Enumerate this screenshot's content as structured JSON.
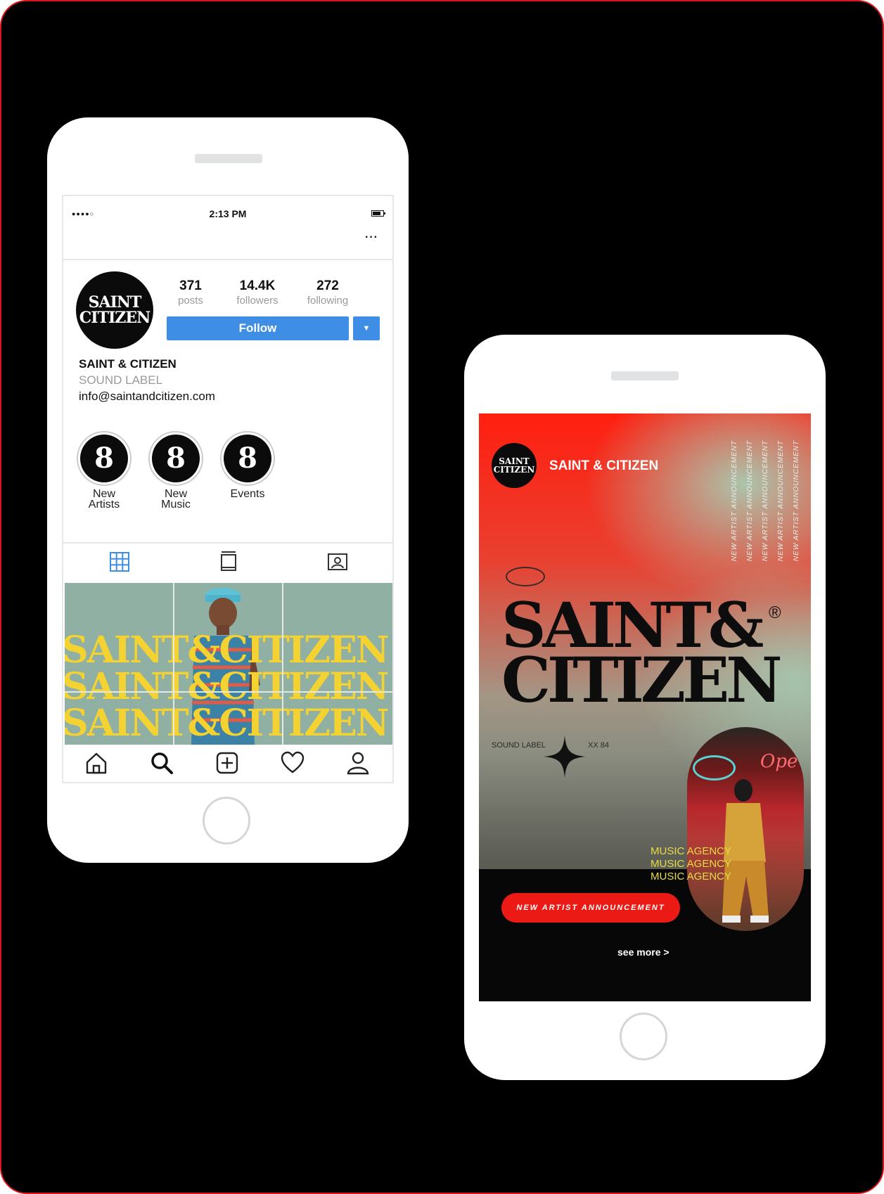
{
  "colors": {
    "background": "#000000",
    "border_accent": "#d9141c",
    "follow_blue": "#3f8ee6",
    "announce_red": "#ec1a14",
    "agency_yellow": "#e6dc46"
  },
  "profile_phone": {
    "status": {
      "signal": "●●●●○",
      "time": "2:13 PM"
    },
    "more_menu": "···",
    "avatar_logo": {
      "line1": "SAINT",
      "line2": "CITIZEN"
    },
    "stats": [
      {
        "num": "371",
        "label": "posts"
      },
      {
        "num": "14.4K",
        "label": "followers"
      },
      {
        "num": "272",
        "label": "following"
      }
    ],
    "follow_label": "Follow",
    "dropdown_glyph": "▼",
    "name": "SAINT & CITIZEN",
    "category": "SOUND LABEL",
    "email": "info@saintandcitizen.com",
    "highlights": [
      {
        "glyph": "8",
        "label": "New\nArtists"
      },
      {
        "glyph": "8",
        "label": "New\nMusic"
      },
      {
        "glyph": "8",
        "label": "Events"
      }
    ],
    "tabs": [
      "grid-icon",
      "feed-icon",
      "tagged-icon"
    ],
    "grid_text": [
      "SAINT&CITIZEN",
      "SAINT&CITIZEN",
      "SAINT&CITIZEN"
    ],
    "nav": [
      "home-icon",
      "search-icon",
      "add-post-icon",
      "heart-icon",
      "profile-icon"
    ]
  },
  "story_phone": {
    "account_logo": {
      "line1": "SAINT",
      "line2": "CITIZEN"
    },
    "account_name": "SAINT & CITIZEN",
    "vertical_text": [
      "NEW ARTIST ANNOUNCEMENT",
      "NEW ARTIST ANNOUNCEMENT",
      "NEW ARTIST ANNOUNCEMENT",
      "NEW ARTIST ANNOUNCEMENT",
      "NEW ARTIST ANNOUNCEMENT"
    ],
    "title_line1": "SAINT&",
    "title_line2": "CITIZEN",
    "registered": "®",
    "sound_label": "SOUND LABEL",
    "xx_label": "XX  84",
    "neon_sign": "Ope",
    "agency_lines": [
      "MUSIC AGENCY",
      "MUSIC AGENCY",
      "MUSIC AGENCY"
    ],
    "announce_label": "NEW ARTIST ANNOUNCEMENT",
    "see_more": "see more >"
  }
}
